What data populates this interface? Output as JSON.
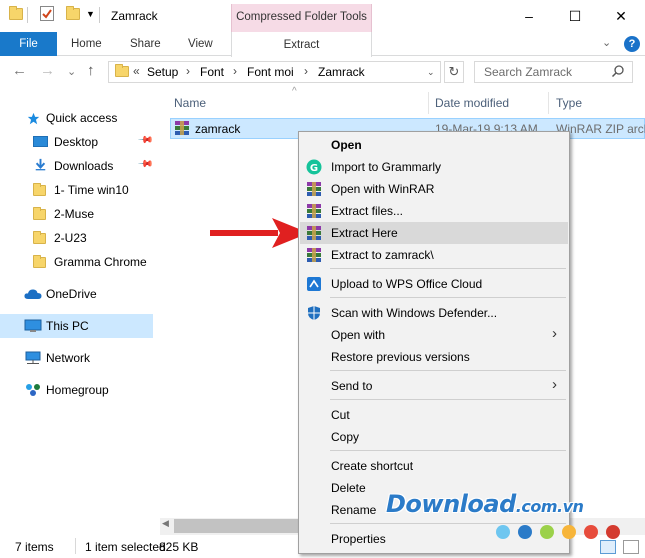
{
  "window": {
    "title": "Zamrack",
    "context_tab_group": "Compressed Folder Tools",
    "minimize": "–",
    "maximize": "☐",
    "close": "✕"
  },
  "ribbon": {
    "file": "File",
    "home": "Home",
    "share": "Share",
    "view": "View",
    "extract": "Extract",
    "help": "?",
    "collapse": "⌄"
  },
  "nav": {
    "back": "←",
    "forward": "→",
    "recent": "⌄",
    "up": "↑",
    "overflow": "«",
    "breadcrumb": [
      "Setup",
      "Font",
      "Font moi",
      "Zamrack"
    ],
    "refresh": "↻",
    "search_placeholder": "Search Zamrack"
  },
  "sidebar": {
    "quick_access": "Quick access",
    "items": [
      {
        "label": "Desktop",
        "pinned": true
      },
      {
        "label": "Downloads",
        "pinned": true
      },
      {
        "label": "1- Time win10"
      },
      {
        "label": "2-Muse"
      },
      {
        "label": "2-U23"
      },
      {
        "label": "Gramma Chrome"
      }
    ],
    "onedrive": "OneDrive",
    "thispc": "This PC",
    "network": "Network",
    "homegroup": "Homegroup"
  },
  "file_list": {
    "columns": [
      "Name",
      "Date modified",
      "Type"
    ],
    "rows": [
      {
        "name": "zamrack",
        "date": "19-Mar-19 9:13 AM",
        "type": "WinRAR ZIP archive"
      }
    ]
  },
  "status": {
    "count": "7 items",
    "selection": "1 item selected",
    "size": "825 KB"
  },
  "context_menu": {
    "items": [
      {
        "label": "Open",
        "bold": true
      },
      {
        "label": "Import to Grammarly",
        "icon": "grammarly-icon"
      },
      {
        "label": "Open with WinRAR",
        "icon": "winrar-icon"
      },
      {
        "label": "Extract files...",
        "icon": "winrar-icon"
      },
      {
        "label": "Extract Here",
        "icon": "winrar-icon",
        "highlighted": true
      },
      {
        "label": "Extract to zamrack\\",
        "icon": "winrar-icon"
      },
      {
        "label": "Upload to WPS Office Cloud",
        "icon": "wps-cloud-icon"
      },
      {
        "label": "Scan with Windows Defender...",
        "icon": "defender-icon"
      },
      {
        "label": "Open with",
        "submenu": true
      },
      {
        "label": "Restore previous versions"
      },
      {
        "label": "Send to",
        "submenu": true
      },
      {
        "label": "Cut"
      },
      {
        "label": "Copy"
      },
      {
        "label": "Create shortcut"
      },
      {
        "label": "Delete"
      },
      {
        "label": "Rename"
      },
      {
        "label": "Properties"
      }
    ],
    "submenu_glyph": "›"
  },
  "watermark": {
    "main": "Download",
    "suffix": ".com.vn"
  },
  "colors": {
    "accent": "#1979ca",
    "selection": "#cce8ff",
    "context_tab": "#f6dbe6",
    "arrow": "#e02020",
    "watermark": "#2b7bc8"
  }
}
